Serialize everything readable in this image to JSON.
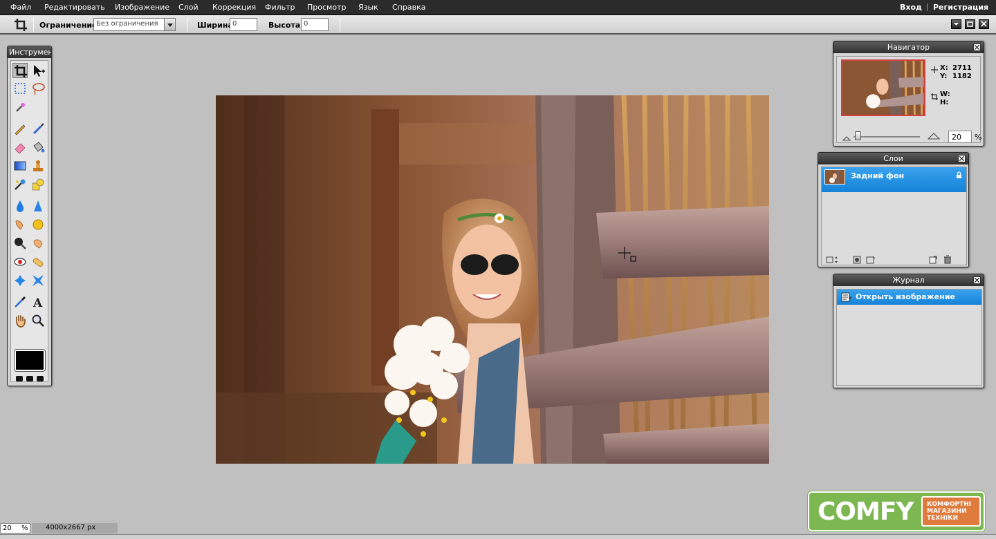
{
  "menu": {
    "items": [
      "Файл",
      "Редактировать",
      "Изображение",
      "Слой",
      "Коррекция",
      "Фильтр",
      "Просмотр",
      "Язык",
      "Справка"
    ],
    "login": "Вход",
    "register": "Регистрация"
  },
  "options": {
    "constraint_label": "Ограничение:",
    "constraint_value": "Без ограничения",
    "width_label": "Ширина:",
    "width_value": "0",
    "height_label": "Высота:",
    "height_value": "0"
  },
  "tools": {
    "title": "Инструменты",
    "selected": "crop-tool",
    "foreground_color": "#000000"
  },
  "navigator": {
    "title": "Навигатор",
    "x_label": "X:",
    "x_value": "2711",
    "y_label": "Y:",
    "y_value": "1182",
    "w_label": "W:",
    "w_value": "",
    "h_label": "H:",
    "h_value": "",
    "zoom": "20",
    "zoom_unit": "%"
  },
  "layers": {
    "title": "Слои",
    "items": [
      {
        "name": "Задний фон",
        "locked": true
      }
    ]
  },
  "history": {
    "title": "Журнал",
    "items": [
      {
        "name": "Открыть изображение"
      }
    ]
  },
  "status": {
    "zoom": "20",
    "zoom_unit": "%",
    "dimensions": "4000x2667 px"
  },
  "branding": {
    "logo_word": "COMFY",
    "logo_tag": "КОМФОРТНІ МАГАЗИНИ ТЕХНІКИ"
  },
  "colors": {
    "menubar": "#2b2b2b",
    "selection": "#1e8fe3",
    "workspace": "#c0c0c0",
    "comfy_green": "#7cb752",
    "comfy_orange": "#e07b3e"
  }
}
